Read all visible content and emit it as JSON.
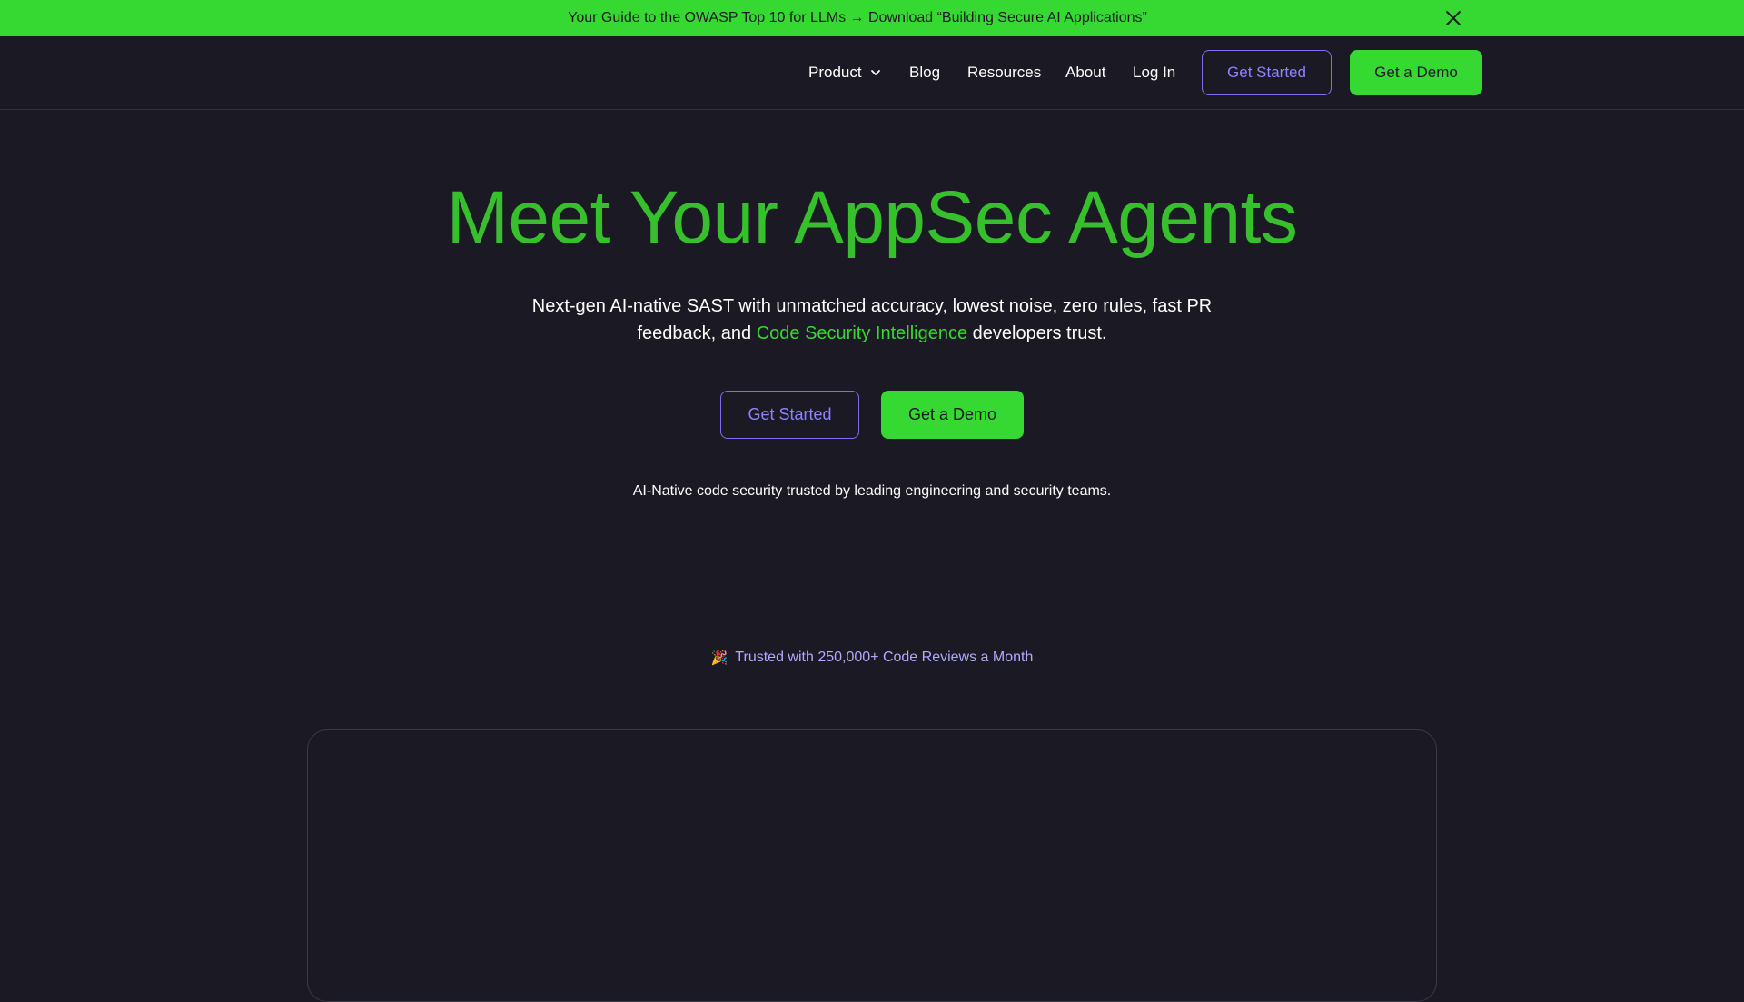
{
  "announcement": {
    "text": "Your Guide to the OWASP Top 10 for LLMs → Download “Building Secure AI Applications”",
    "close_icon": "close-icon"
  },
  "nav": {
    "items": [
      {
        "label": "Product",
        "has_dropdown": true
      },
      {
        "label": "Blog"
      },
      {
        "label": "Resources"
      },
      {
        "label": "About"
      },
      {
        "label": "Log In"
      }
    ],
    "get_started": "Get Started",
    "get_demo": "Get a Demo"
  },
  "hero": {
    "title": "Meet Your AppSec Agents",
    "subtitle_before": "Next-gen AI-native SAST with unmatched accuracy, lowest noise, zero rules, fast PR feedback, and ",
    "subtitle_highlight": "Code Security Intelligence",
    "subtitle_after": " developers trust.",
    "get_started": "Get Started",
    "get_demo": "Get a Demo",
    "trust_line": "AI-Native code security trusted by leading engineering and security teams."
  },
  "reviews": {
    "emoji": "🎉",
    "text": "Trusted with 250,000+ Code Reviews a Month"
  },
  "colors": {
    "background": "#1b1a24",
    "brand_green": "#36d931",
    "title_green": "#36c02c",
    "accent_purple": "#8f82ff"
  }
}
